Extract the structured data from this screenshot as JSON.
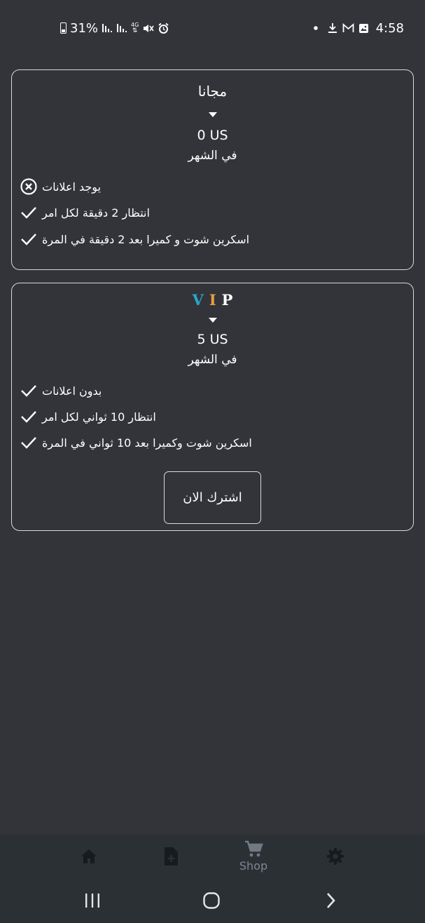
{
  "status_bar": {
    "battery_percent": "31%",
    "network_type": "4G",
    "time": "4:58",
    "icons_left": [
      "battery-icon",
      "signal-icon",
      "signal-icon",
      "data-4g-icon",
      "mute-icon",
      "alarm-icon"
    ],
    "icons_right": [
      "dot-icon",
      "download-icon",
      "gmail-icon",
      "gallery-icon"
    ]
  },
  "plans": {
    "free": {
      "title": "مجانا",
      "price": "0 US",
      "period": "في الشهر",
      "features": [
        {
          "text": "يوجد اعلانات",
          "icon": "x-circle-icon"
        },
        {
          "text": "انتظار 2 دقيقة لكل امر",
          "icon": "check-icon"
        },
        {
          "text": "اسكرين شوت و كميرا بعد 2 دقيقة في المرة",
          "icon": "check-icon"
        }
      ]
    },
    "vip": {
      "title_letters": [
        {
          "char": "V",
          "color": "#2aa7c9"
        },
        {
          "char": "I",
          "color": "#e8a23a"
        },
        {
          "char": "P",
          "color": "#ffffff"
        }
      ],
      "price": "5 US",
      "period": "في الشهر",
      "features": [
        {
          "text": "بدون اعلانات",
          "icon": "check-icon"
        },
        {
          "text": "انتظار 10 ثواني لكل امر",
          "icon": "check-icon"
        },
        {
          "text": "اسكرين شوت وكميرا بعد 10 ثواني في المرة",
          "icon": "check-icon"
        }
      ],
      "subscribe_label": "اشترك الان"
    }
  },
  "bottom_nav": {
    "items": [
      {
        "name": "home",
        "icon": "home-icon",
        "label": "",
        "active": false
      },
      {
        "name": "new-file",
        "icon": "add-file-icon",
        "label": "",
        "active": false
      },
      {
        "name": "shop",
        "icon": "cart-icon",
        "label": "Shop",
        "active": true
      },
      {
        "name": "settings",
        "icon": "gear-icon",
        "label": "",
        "active": false
      }
    ],
    "icon_color": "#171b1f",
    "active_color": "#6f7a83"
  },
  "system_nav": {
    "buttons": [
      "recents-icon",
      "home-circle-icon",
      "back-chevron-icon"
    ]
  }
}
